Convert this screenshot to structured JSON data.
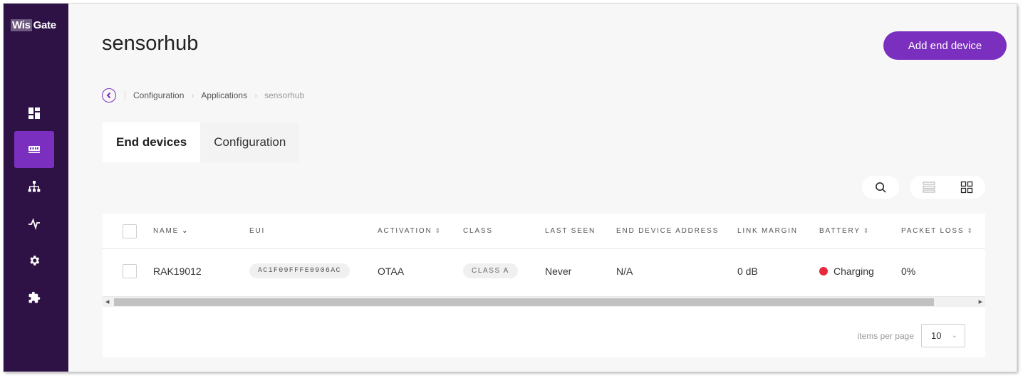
{
  "brand": {
    "logo_part1": "Wis",
    "logo_part2": "Gate"
  },
  "sidebar": {
    "items": [
      {
        "name": "dashboard",
        "icon": "dashboard-icon",
        "active": false
      },
      {
        "name": "gateways",
        "icon": "gateway-icon",
        "active": true
      },
      {
        "name": "network",
        "icon": "network-tree-icon",
        "active": false
      },
      {
        "name": "activity",
        "icon": "pulse-icon",
        "active": false
      },
      {
        "name": "settings",
        "icon": "gear-icon",
        "active": false
      },
      {
        "name": "extensions",
        "icon": "puzzle-icon",
        "active": false
      }
    ]
  },
  "header": {
    "title": "sensorhub",
    "add_button": "Add end device"
  },
  "breadcrumb": {
    "items": [
      "Configuration",
      "Applications"
    ],
    "current": "sensorhub"
  },
  "tabs": [
    {
      "label": "End devices",
      "active": true
    },
    {
      "label": "Configuration",
      "active": false
    }
  ],
  "table": {
    "headers": {
      "name": "NAME",
      "eui": "EUI",
      "activation": "ACTIVATION",
      "class": "CLASS",
      "last_seen": "LAST SEEN",
      "address": "END DEVICE ADDRESS",
      "link_margin": "LINK MARGIN",
      "battery": "BATTERY",
      "packet_loss": "PACKET LOSS"
    },
    "rows": [
      {
        "name": "RAK19012",
        "eui": "AC1F09FFFE0906AC",
        "activation": "OTAA",
        "class": "CLASS A",
        "last_seen": "Never",
        "address": "N/A",
        "link_margin": "0 dB",
        "battery": "Charging",
        "packet_loss": "0%"
      }
    ]
  },
  "pager": {
    "label": "items per page",
    "value": "10"
  },
  "colors": {
    "accent": "#7b2fbe",
    "sidebar": "#2e1245",
    "battery_status": "#e8283f"
  }
}
